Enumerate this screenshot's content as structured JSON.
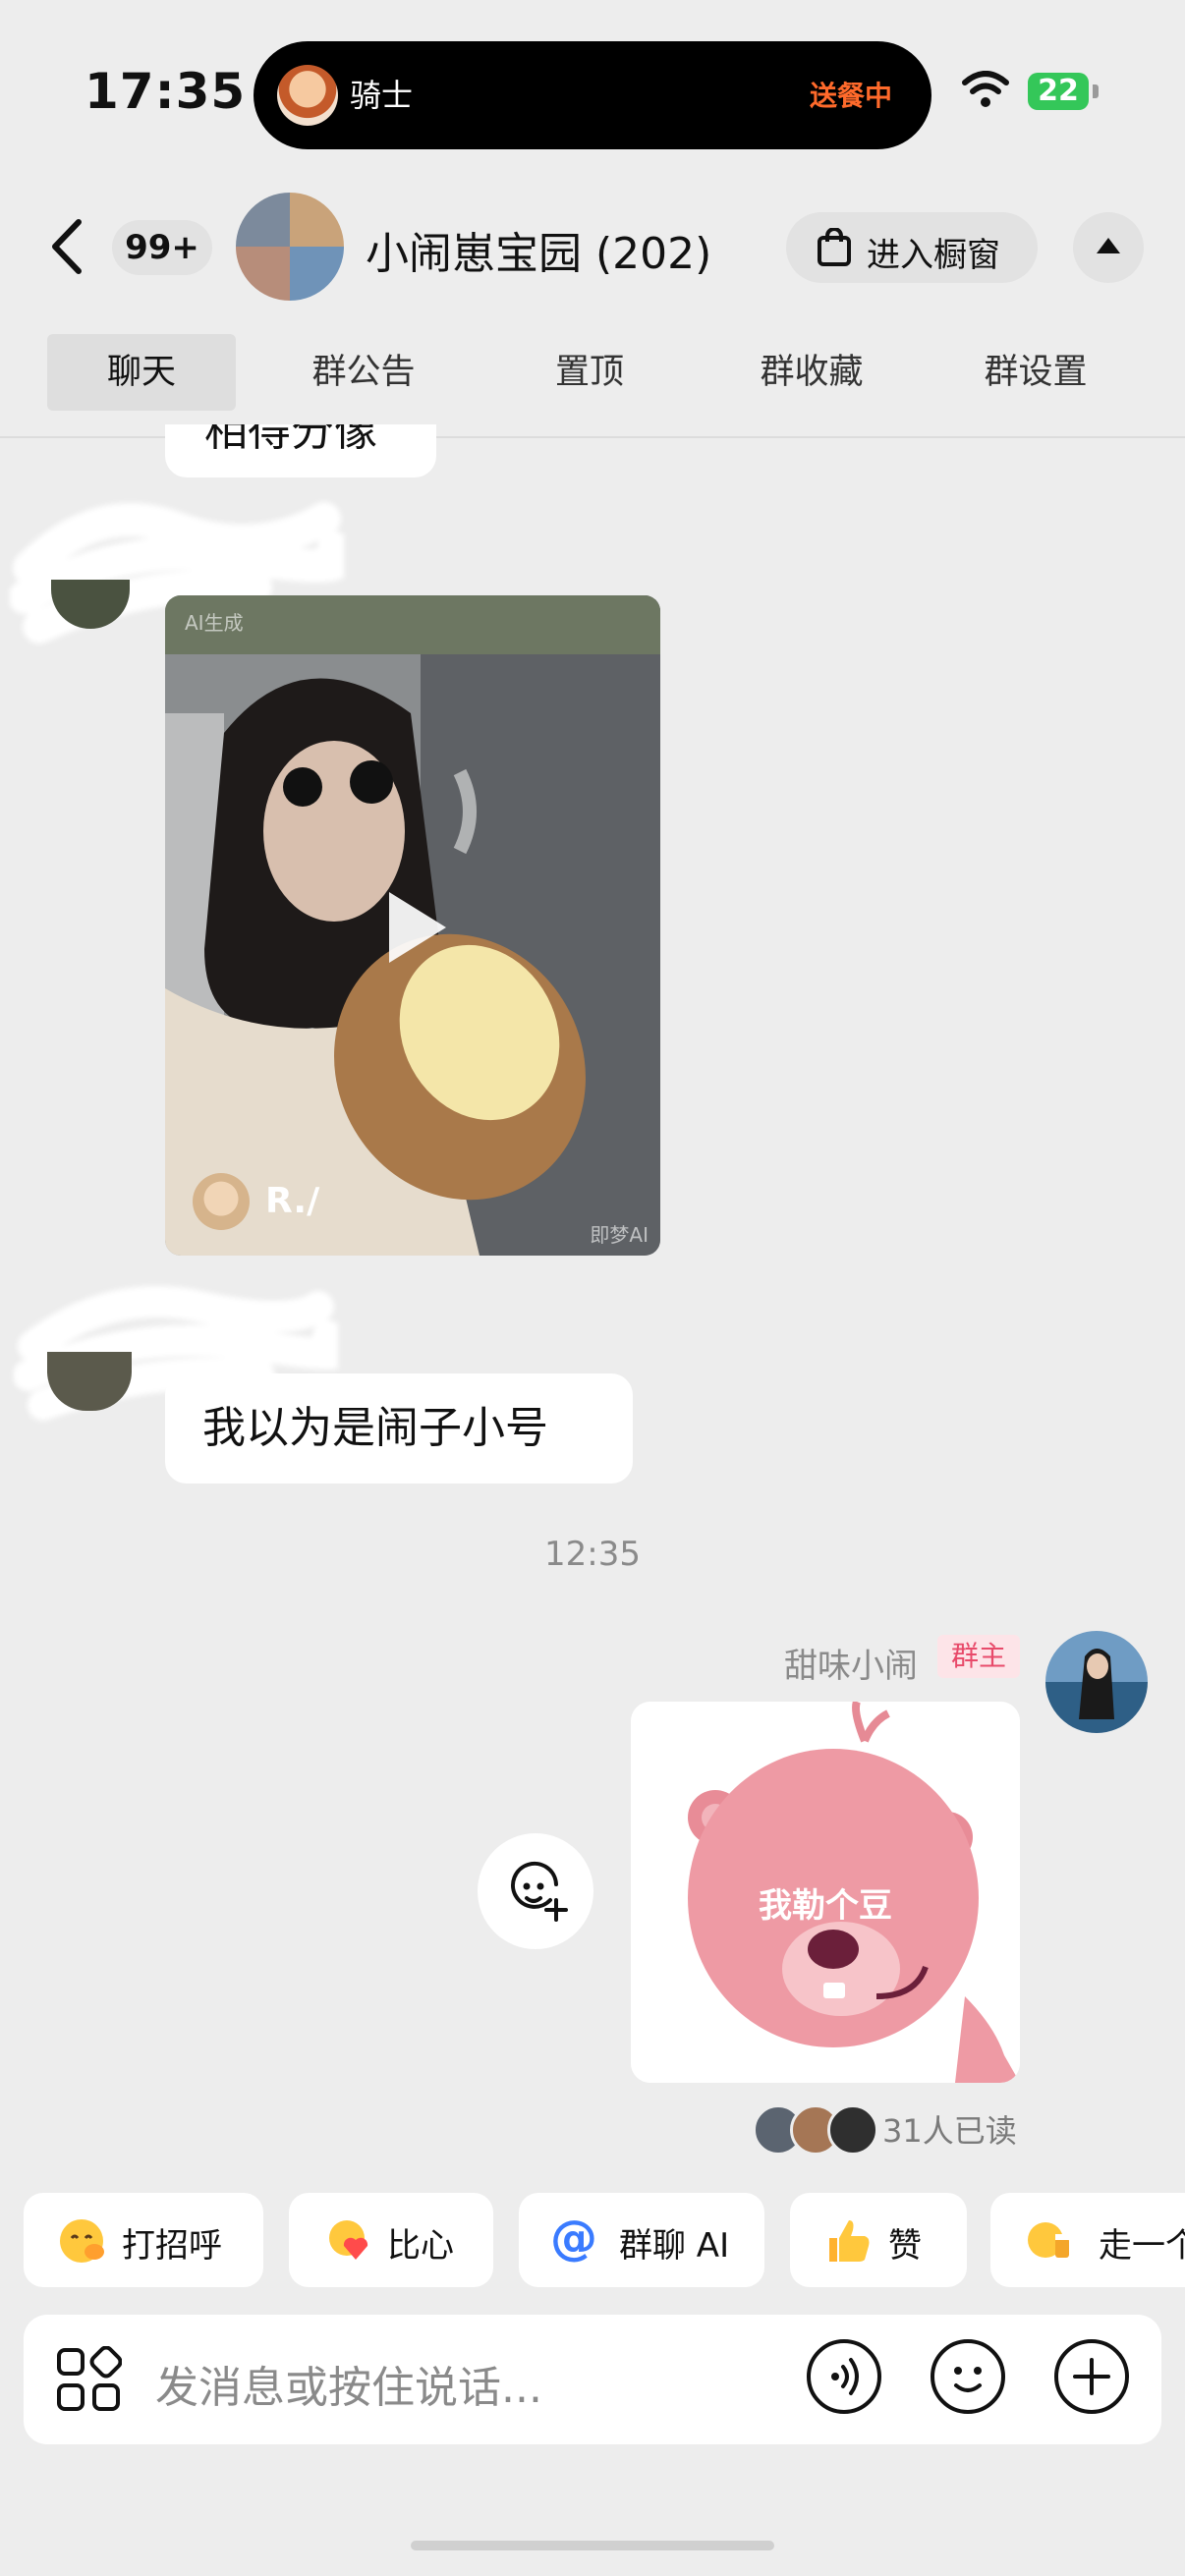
{
  "status_bar": {
    "time": "17:35",
    "battery": "22"
  },
  "live_activity": {
    "title": "骑士",
    "status": "送餐中"
  },
  "header": {
    "unread_badge": "99+",
    "group_name": "小闹崽宝园 (202)",
    "shop_button": "进入橱窗"
  },
  "tabs": [
    "聊天",
    "群公告",
    "置顶",
    "群收藏",
    "群设置"
  ],
  "messages": {
    "partial_top": "相得分像",
    "video": {
      "author": "R./",
      "watermark_top": "AI生成",
      "watermark_bottom": "即梦AI"
    },
    "text_reply": "我以为是闹子小号",
    "timestamp": "12:35",
    "sender_name": "甜味小闹",
    "sender_role": "群主",
    "sticker_text": "我勒个豆",
    "read_receipt": "31人已读"
  },
  "quick_replies": [
    "打招呼",
    "比心",
    "群聊 AI",
    "赞",
    "走一个"
  ],
  "input": {
    "placeholder": "发消息或按住说话..."
  },
  "colors": {
    "background": "#ededed",
    "role_tag": "#e84a6a",
    "delivery_status": "#ff6a2b",
    "battery": "#34c759"
  }
}
